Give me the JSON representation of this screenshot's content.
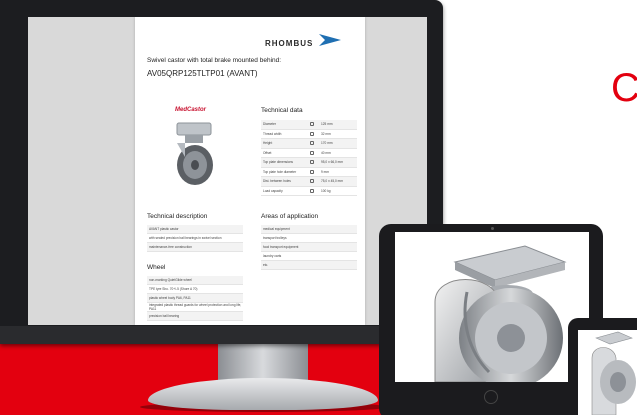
{
  "brand": {
    "name": "RHOMBUS",
    "accent_color": "#e3000f",
    "logo_icon": "rhombus-chevron-icon"
  },
  "page_letter": "C",
  "document": {
    "subtitle": "Swivel castor with total brake mounted behind:",
    "code": "AV05QRP125TLTP01 (AVANT)",
    "product_logo": "MedCastor",
    "technical_data": {
      "title": "Technical data",
      "rows": [
        {
          "label": "Diameter",
          "icon": "diameter-icon",
          "value": "125 mm"
        },
        {
          "label": "Thread width",
          "icon": "width-icon",
          "value": "32 mm"
        },
        {
          "label": "Height",
          "icon": "height-icon",
          "value": "170 mm"
        },
        {
          "label": "Offset",
          "icon": "offset-icon",
          "value": "40 mm"
        },
        {
          "label": "Top plate dimensions",
          "icon": "plate-icon",
          "value": "95,0 x 66,0 mm"
        },
        {
          "label": "Top plate hole diameter",
          "icon": "hole-icon",
          "value": "9 mm"
        },
        {
          "label": "Dist. between holes",
          "icon": "distance-icon",
          "value": "75,0 x 45,0 mm"
        },
        {
          "label": "Load capacity",
          "icon": "load-icon",
          "value": "100 kg"
        }
      ]
    },
    "technical_description": {
      "title": "Technical description",
      "items": [
        "AVANT plastic castor",
        "with sealed precision ball bearings in swivel section",
        "maintenance-free construction"
      ]
    },
    "areas_of_application": {
      "title": "Areas of application",
      "items": [
        "medical equipment",
        "transport trolleys",
        "food transport equipment",
        "laundry carts",
        "etc."
      ]
    },
    "wheel": {
      "title": "Wheel",
      "items": [
        "non-marking QuietGlide wheel",
        "TPE tyre Sho. 70+/-5 (Shore A 70)",
        "plastic wheel body PA6, PA11",
        "integrated plastic thread guards for wheel protection and long life, PA11",
        "precision ball bearing"
      ]
    }
  }
}
